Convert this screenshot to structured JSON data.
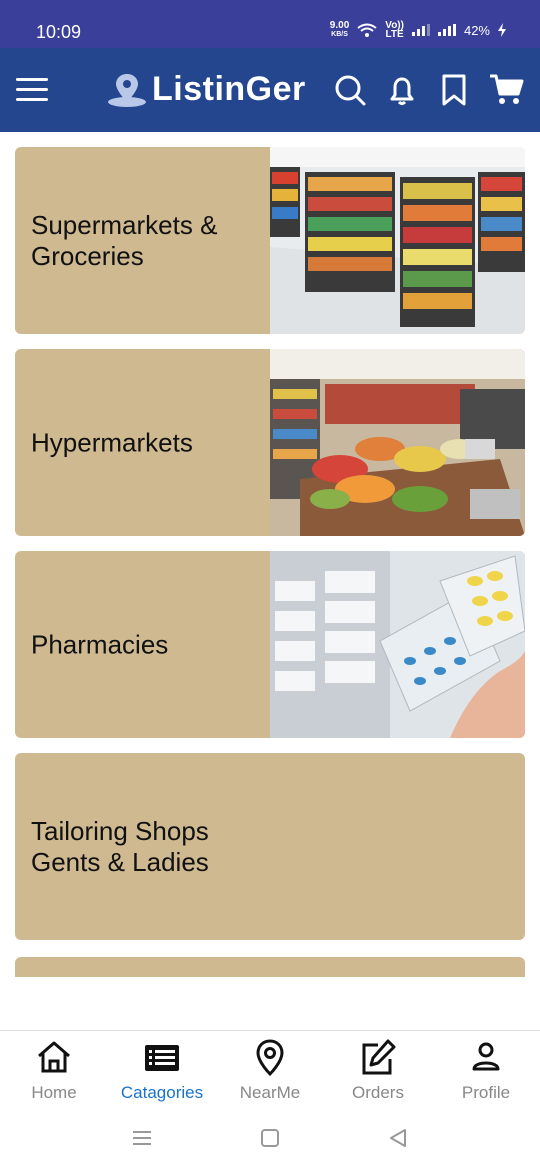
{
  "status_bar": {
    "time": "10:09",
    "speed_value": "9.00",
    "speed_unit": "KB/S",
    "network_top": "Vo))",
    "network_bottom": "LTE",
    "battery": "42%"
  },
  "app_bar": {
    "logo_text": "ListinGer",
    "icons": [
      "menu-icon",
      "search-icon",
      "bell-icon",
      "bookmark-icon",
      "cart-icon"
    ],
    "background": "#24468f"
  },
  "categories": [
    {
      "label_line1": "Supermarkets &",
      "label_line2": "Groceries",
      "image": "supermarket-shelves-image"
    },
    {
      "label_line1": "Hypermarkets",
      "label_line2": "",
      "image": "hypermarket-produce-image"
    },
    {
      "label_line1": "Pharmacies",
      "label_line2": "",
      "image": "pharmacy-pills-image"
    },
    {
      "label_line1": "Tailoring Shops",
      "label_line2": "Gents & Ladies",
      "image": ""
    }
  ],
  "card_color": "#cfb991",
  "bottom_nav": {
    "items": [
      {
        "label": "Home",
        "icon": "home-icon"
      },
      {
        "label": "Catagories",
        "icon": "list-icon"
      },
      {
        "label": "NearMe",
        "icon": "location-pin-icon"
      },
      {
        "label": "Orders",
        "icon": "edit-icon"
      },
      {
        "label": "Profile",
        "icon": "person-icon"
      }
    ],
    "active": "Catagories",
    "active_color": "#1a73c9"
  }
}
